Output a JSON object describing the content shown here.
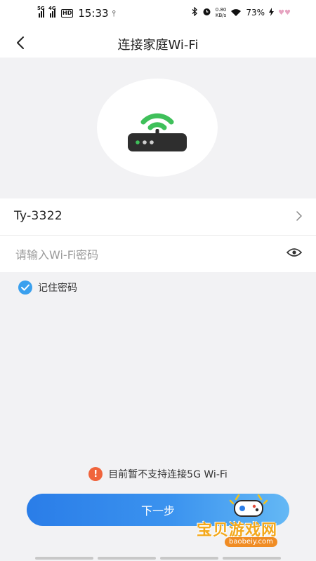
{
  "status_bar": {
    "signal1_label": "5G",
    "signal2_label": "4G",
    "hd_label": "HD",
    "time": "15:33",
    "usb_icon": "⫯",
    "net_speed_value": "0.80",
    "net_speed_unit": "KB/s",
    "battery_percent": "73%"
  },
  "header": {
    "title": "连接家庭Wi-Fi"
  },
  "wifi": {
    "ssid": "Ty-3322",
    "password_placeholder": "请输入Wi-Fi密码",
    "password_value": ""
  },
  "remember": {
    "label": "记住密码",
    "checked": true
  },
  "notice": {
    "text": "目前暂不支持连接5G Wi-Fi"
  },
  "actions": {
    "next_label": "下一步"
  },
  "watermark": {
    "title": "宝贝游戏网",
    "url": "baobeiy.com"
  },
  "colors": {
    "accent_blue": "#2a7de8",
    "wifi_green": "#3fc05a",
    "warning_orange": "#f0643c",
    "checkbox_blue": "#3aa0ee"
  }
}
